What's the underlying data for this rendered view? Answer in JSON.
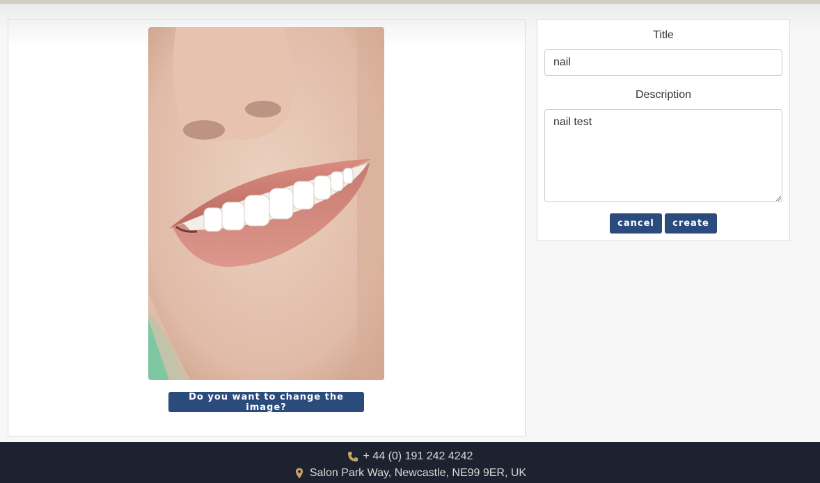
{
  "image_panel": {
    "photo_alt": "Close-up of a smiling mouth with white teeth",
    "change_button_label": "Do you want to change the image?"
  },
  "form": {
    "title_label": "Title",
    "title_value": "nail",
    "description_label": "Description",
    "description_value": "nail test",
    "cancel_label": "cancel",
    "create_label": "create"
  },
  "footer": {
    "phone": "+ 44 (0) 191 242 4242",
    "address": "Salon Park Way, Newcastle, NE99 9ER, UK",
    "icon_phone": "phone-icon",
    "icon_address": "map-pin-icon"
  },
  "colors": {
    "button": "#2a4b7c",
    "footer_bg": "#1d2230",
    "footer_icon": "#c9a26b",
    "page_bg": "#f7f7f7"
  }
}
